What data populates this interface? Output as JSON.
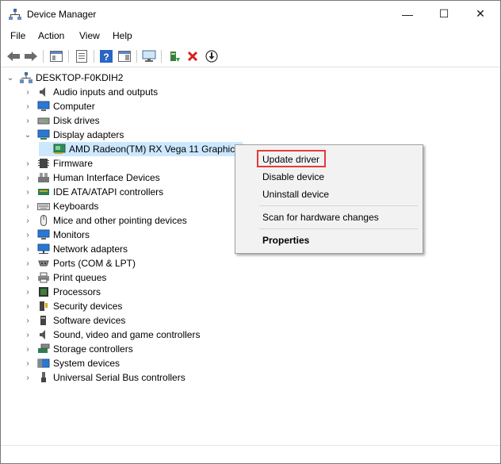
{
  "window": {
    "title": "Device Manager",
    "controls": {
      "minimize": "—",
      "maximize": "☐",
      "close": "✕"
    }
  },
  "menu": {
    "items": [
      "File",
      "Action",
      "View",
      "Help"
    ]
  },
  "toolbar": {
    "icons": [
      "back-icon",
      "forward-icon",
      "show-hide-console-tree-icon",
      "properties-sheet-icon",
      "help-icon",
      "action-pane-icon",
      "monitor-icon",
      "update-driver-icon",
      "uninstall-icon",
      "enable-device-icon"
    ]
  },
  "tree": {
    "root": "DESKTOP-F0KDIH2",
    "categories": [
      {
        "label": "Audio inputs and outputs",
        "icon": "speaker-icon"
      },
      {
        "label": "Computer",
        "icon": "computer-icon"
      },
      {
        "label": "Disk drives",
        "icon": "disk-drive-icon"
      },
      {
        "label": "Display adapters",
        "icon": "display-adapter-icon",
        "expanded": true,
        "children": [
          {
            "label": "AMD Radeon(TM) RX Vega 11 Graphics",
            "icon": "graphics-card-icon"
          }
        ]
      },
      {
        "label": "Firmware",
        "icon": "firmware-icon"
      },
      {
        "label": "Human Interface Devices",
        "icon": "hid-icon"
      },
      {
        "label": "IDE ATA/ATAPI controllers",
        "icon": "ide-controller-icon"
      },
      {
        "label": "Keyboards",
        "icon": "keyboard-icon"
      },
      {
        "label": "Mice and other pointing devices",
        "icon": "mouse-icon"
      },
      {
        "label": "Monitors",
        "icon": "monitor-icon"
      },
      {
        "label": "Network adapters",
        "icon": "network-adapter-icon"
      },
      {
        "label": "Ports (COM & LPT)",
        "icon": "port-icon"
      },
      {
        "label": "Print queues",
        "icon": "printer-icon"
      },
      {
        "label": "Processors",
        "icon": "processor-icon"
      },
      {
        "label": "Security devices",
        "icon": "security-device-icon"
      },
      {
        "label": "Software devices",
        "icon": "software-device-icon"
      },
      {
        "label": "Sound, video and game controllers",
        "icon": "sound-icon"
      },
      {
        "label": "Storage controllers",
        "icon": "storage-controller-icon"
      },
      {
        "label": "System devices",
        "icon": "system-device-icon"
      },
      {
        "label": "Universal Serial Bus controllers",
        "icon": "usb-icon"
      }
    ]
  },
  "context_menu": {
    "items": [
      {
        "label": "Update driver",
        "highlighted": true
      },
      {
        "label": "Disable device"
      },
      {
        "label": "Uninstall device"
      },
      {
        "label": "Scan for hardware changes"
      },
      {
        "label": "Properties",
        "bold": true
      }
    ]
  },
  "colors": {
    "selection": "#cce8ff",
    "highlight_border": "#e23b3b",
    "menu_bg": "#f2f2f2"
  }
}
